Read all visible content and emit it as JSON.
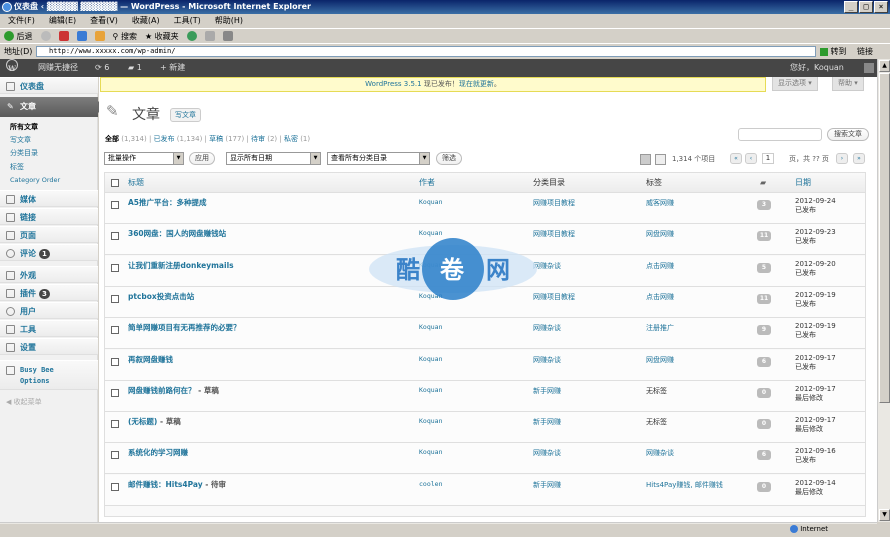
{
  "browser": {
    "window_title": "仪表盘 ‹ ▓▓▓▓▓ ▓▓▓▓▓▓ — WordPress - Microsoft Internet Explorer",
    "menu": [
      "文件(F)",
      "编辑(E)",
      "查看(V)",
      "收藏(A)",
      "工具(T)",
      "帮助(H)"
    ],
    "toolbar": {
      "back": "后退",
      "search": "搜索",
      "favorites": "收藏夹"
    },
    "address_label": "地址(D)",
    "address": "http://www.xxxxx.com/wp-admin/",
    "go": "转到",
    "links": "链接",
    "status_zone": "Internet"
  },
  "adminbar": {
    "site_name": "网赚无捷径",
    "updates": "6",
    "comments": "1",
    "new_label": "新建",
    "greeting": "您好，Koquan"
  },
  "screen_tabs": {
    "options": "显示选项",
    "help": "帮助"
  },
  "update_nag": {
    "text_a": "WordPress 3.5.1",
    "text_b": " 现已发布！",
    "text_c": "现在就更新",
    "text_d": "。"
  },
  "sidebar": {
    "dashboard": "仪表盘",
    "posts": "文章",
    "sub": [
      "所有文章",
      "写文章",
      "分类目录",
      "标签",
      "Category Order"
    ],
    "media": "媒体",
    "links": "链接",
    "pages": "页面",
    "comments": "评论",
    "comments_badge": "1",
    "appearance": "外观",
    "plugins": "插件",
    "plugins_badge": "3",
    "users": "用户",
    "tools": "工具",
    "settings": "设置",
    "busybee1": "Busy Bee",
    "busybee2": "Options",
    "collapse": "收起菜单"
  },
  "page": {
    "title": "文章",
    "add_new": "写文章",
    "filters": {
      "all": "全部",
      "all_count": "(1,314)",
      "published": "已发布",
      "published_count": "(1,134)",
      "draft": "草稿",
      "draft_count": "(177)",
      "pending": "待审",
      "pending_count": "(2)",
      "private": "私密",
      "private_count": "(1)"
    },
    "search_button": "搜索文章",
    "bulk_action": "批量操作",
    "apply": "应用",
    "all_dates": "显示所有日期",
    "all_categories": "查看所有分类目录",
    "filter": "筛选",
    "items": "1,314 个项目",
    "page_current": "1",
    "page_total": "页，共 ?? 页"
  },
  "table": {
    "headers": {
      "title": "标题",
      "author": "作者",
      "categories": "分类目录",
      "tags": "标签",
      "date": "日期"
    },
    "rows": [
      {
        "title": "A5推广平台：多种提成",
        "state": "",
        "author": "Koquan",
        "cat": "网赚项目教程",
        "tag": "威客网赚",
        "tag_plain": false,
        "comments": "3",
        "date": "2012-09-24",
        "status": "已发布"
      },
      {
        "title": "360网盘：国人的网盘赚钱站",
        "state": "",
        "author": "Koquan",
        "cat": "网赚项目教程",
        "tag": "网盘网赚",
        "tag_plain": false,
        "comments": "11",
        "date": "2012-09-23",
        "status": "已发布"
      },
      {
        "title": "让我们重新注册donkeymails",
        "state": "",
        "author": "Koquan",
        "cat": "网赚杂谈",
        "tag": "点击网赚",
        "tag_plain": false,
        "comments": "5",
        "date": "2012-09-20",
        "status": "已发布"
      },
      {
        "title": "ptcbox投资点击站",
        "state": "",
        "author": "Koquan",
        "cat": "网赚项目教程",
        "tag": "点击网赚",
        "tag_plain": false,
        "comments": "11",
        "date": "2012-09-19",
        "status": "已发布"
      },
      {
        "title": "简单网赚项目有无再推荐的必要？",
        "state": "",
        "author": "Koquan",
        "cat": "网赚杂谈",
        "tag": "注册推广",
        "tag_plain": false,
        "comments": "9",
        "date": "2012-09-19",
        "status": "已发布"
      },
      {
        "title": "再叙网盘赚钱",
        "state": "",
        "author": "Koquan",
        "cat": "网赚杂谈",
        "tag": "网盘网赚",
        "tag_plain": false,
        "comments": "6",
        "date": "2012-09-17",
        "status": "已发布"
      },
      {
        "title": "网盘赚钱前路何在？",
        "state": " - 草稿",
        "author": "Koquan",
        "cat": "新手网赚",
        "tag": "无标签",
        "tag_plain": true,
        "comments": "0",
        "date": "2012-09-17",
        "status": "最后修改"
      },
      {
        "title": "(无标题)",
        "state": " - 草稿",
        "author": "Koquan",
        "cat": "新手网赚",
        "tag": "无标签",
        "tag_plain": true,
        "comments": "0",
        "date": "2012-09-17",
        "status": "最后修改"
      },
      {
        "title": "系统化的学习网赚",
        "state": "",
        "author": "Koquan",
        "cat": "网赚杂谈",
        "tag": "网赚杂谈",
        "tag_plain": false,
        "comments": "6",
        "date": "2012-09-16",
        "status": "已发布"
      },
      {
        "title": "邮件赚钱：Hits4Pay",
        "state": " - 待审",
        "author": "coolen",
        "cat": "新手网赚",
        "tag": "Hits4Pay赚钱, 邮件赚钱",
        "tag_plain": false,
        "comments": "0",
        "date": "2012-09-14",
        "status": "最后修改"
      }
    ]
  },
  "watermark": {
    "c1": "酷",
    "c2": "卷",
    "c3": "网"
  }
}
